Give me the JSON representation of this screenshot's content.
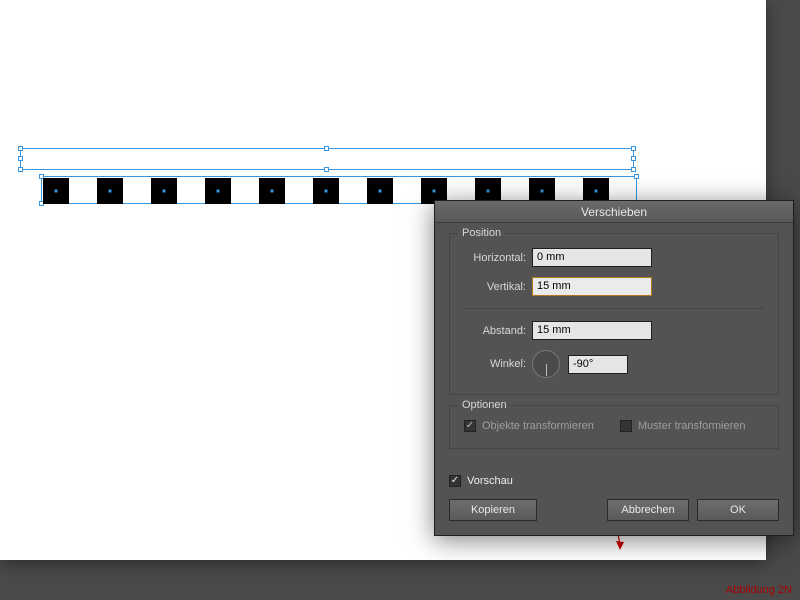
{
  "dialog": {
    "title": "Verschieben",
    "sections": {
      "position": {
        "legend": "Position",
        "horizontal_label": "Horizontal:",
        "horizontal_value": "0 mm",
        "vertikal_label": "Vertikal:",
        "vertikal_value": "15 mm",
        "abstand_label": "Abstand:",
        "abstand_value": "15 mm",
        "winkel_label": "Winkel:",
        "winkel_value": "-90°"
      },
      "optionen": {
        "legend": "Optionen",
        "objekte_label": "Objekte transformieren",
        "objekte_checked": true,
        "muster_label": "Muster transformieren",
        "muster_checked": false
      }
    },
    "vorschau_label": "Vorschau",
    "vorschau_checked": true,
    "buttons": {
      "kopieren": "Kopieren",
      "abbrechen": "Abbrechen",
      "ok": "OK"
    }
  },
  "caption": "Abbildung 2N",
  "colors": {
    "selection": "#3695dd",
    "panel": "#535353"
  },
  "squares_count": 11
}
